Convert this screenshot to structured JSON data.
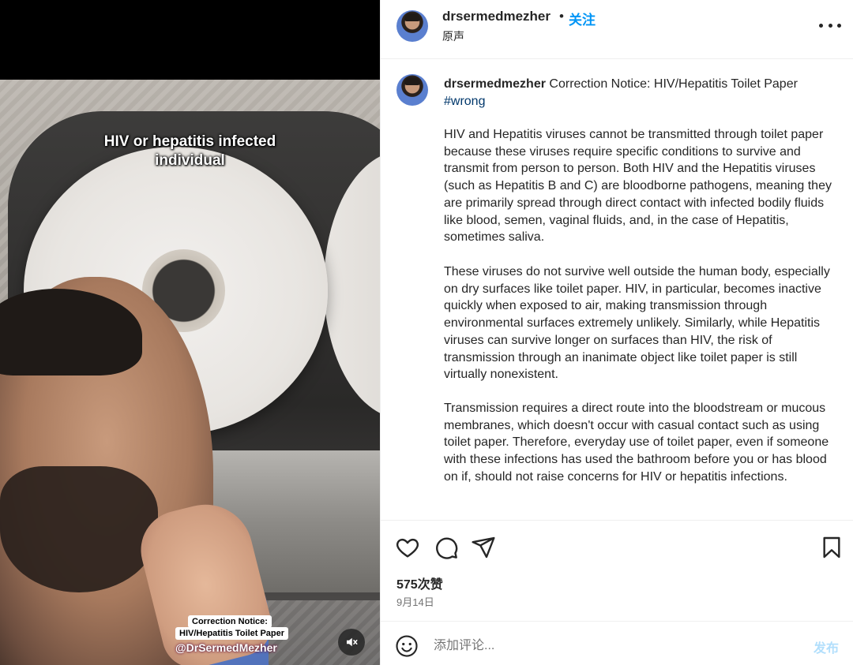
{
  "video": {
    "overlay_top_line1": "HIV or hepatitis infected",
    "overlay_top_line2": "individual",
    "label_line1": "Correction Notice:",
    "label_line2": "HIV/Hepatitis Toilet Paper",
    "handle": "@DrSermedMezher",
    "mute_icon": "speaker-muted-icon"
  },
  "header": {
    "username": "drsermedmezher",
    "separator": "•",
    "follow_label": "关注",
    "audio_label": "原声",
    "more_icon": "more-horizontal-icon"
  },
  "caption": {
    "username": "drsermedmezher",
    "title": "Correction Notice: HIV/Hepatitis Toilet Paper",
    "hashtag": "#wrong",
    "paragraphs": [
      "HIV and Hepatitis viruses cannot be transmitted through toilet paper because these viruses require specific conditions to survive and transmit from person to person. Both HIV and the Hepatitis viruses (such as Hepatitis B and C) are bloodborne pathogens, meaning they are primarily spread through direct contact with infected bodily fluids like blood, semen, vaginal fluids, and, in the case of Hepatitis, sometimes saliva.",
      "These viruses do not survive well outside the human body, especially on dry surfaces like toilet paper. HIV, in particular, becomes inactive quickly when exposed to air, making transmission through environmental surfaces extremely unlikely. Similarly, while Hepatitis viruses can survive longer on surfaces than HIV, the risk of transmission through an inanimate object like toilet paper is still virtually nonexistent.",
      "Transmission requires a direct route into the bloodstream or mucous membranes, which doesn't occur with casual contact such as using toilet paper. Therefore, everyday use of toilet paper, even if someone with these infections has used the bathroom before you or has blood on if, should not raise concerns for HIV or hepatitis infections."
    ]
  },
  "actions": {
    "like_icon": "heart-icon",
    "comment_icon": "comment-bubble-icon",
    "share_icon": "paper-plane-icon",
    "save_icon": "bookmark-icon"
  },
  "stats": {
    "likes": "575次赞",
    "date": "9月14日"
  },
  "comment": {
    "emoji_icon": "emoji-smile-icon",
    "placeholder": "添加评论...",
    "post_label": "发布"
  },
  "colors": {
    "accent": "#0095f6",
    "post_disabled": "#b2dffc",
    "hashtag": "#00376b",
    "muted_text": "#737373"
  }
}
